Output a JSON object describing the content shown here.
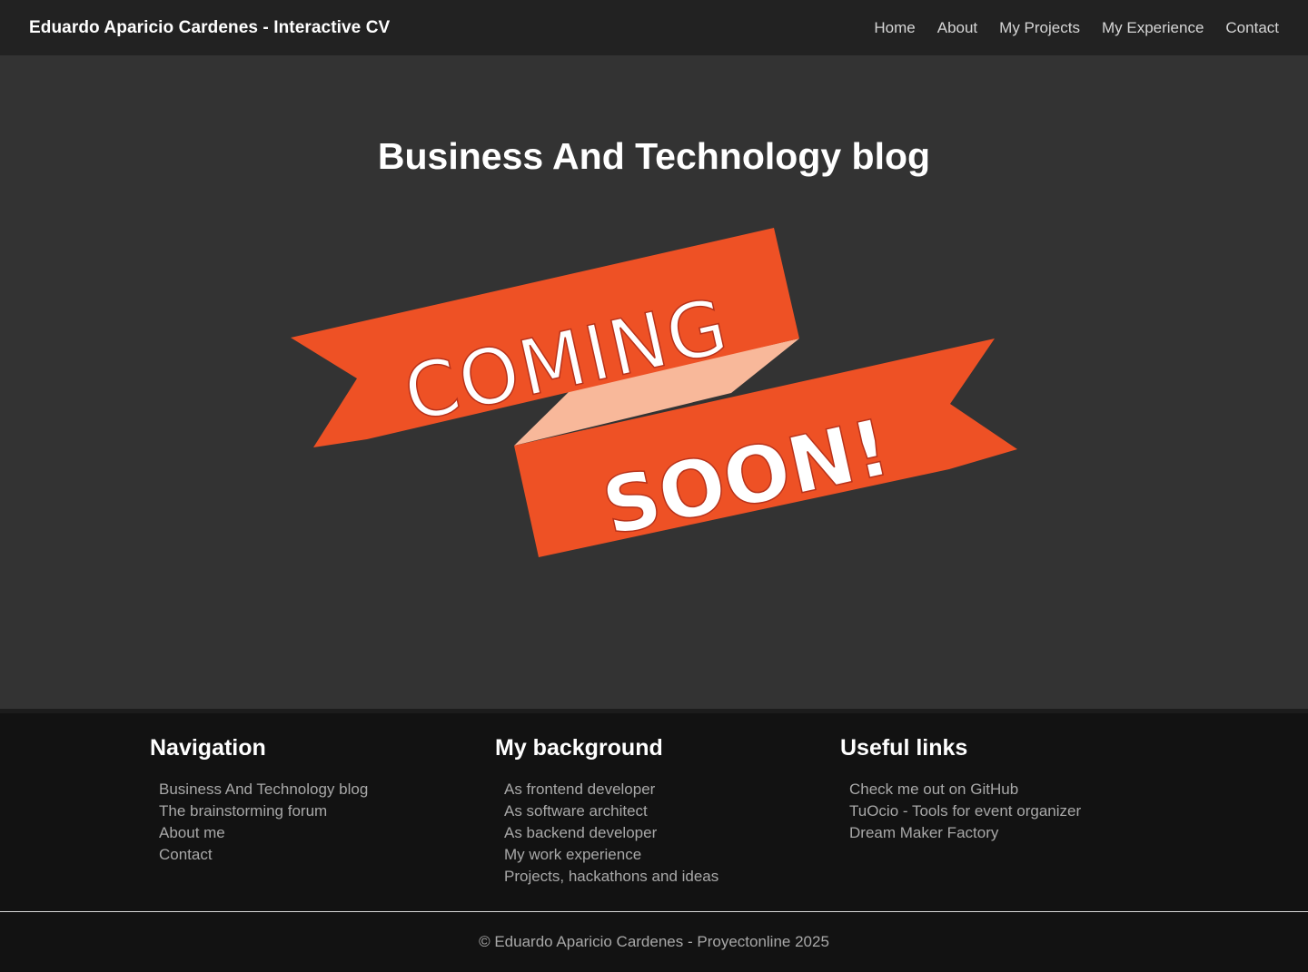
{
  "header": {
    "brand": "Eduardo Aparicio Cardenes - Interactive CV",
    "nav": [
      "Home",
      "About",
      "My Projects",
      "My Experience",
      "Contact"
    ]
  },
  "hero": {
    "title": "Business And Technology blog",
    "banner_text_top": "COMING",
    "banner_text_bottom": "SOON!",
    "colors": {
      "ribbon": "#ee5125",
      "fold": "#f8b89a",
      "background": "#333333"
    }
  },
  "footer": {
    "columns": [
      {
        "heading": "Navigation",
        "links": [
          "Business And Technology blog",
          "The brainstorming forum",
          "About me",
          "Contact"
        ]
      },
      {
        "heading": "My background",
        "links": [
          "As frontend developer",
          "As software architect",
          "As backend developer",
          "My work experience",
          "Projects, hackathons and ideas"
        ]
      },
      {
        "heading": "Useful links",
        "links": [
          "Check me out on GitHub",
          "TuOcio - Tools for event organizer",
          "Dream Maker Factory"
        ]
      }
    ],
    "copyright": "© Eduardo Aparicio Cardenes - Proyectonline 2025"
  }
}
